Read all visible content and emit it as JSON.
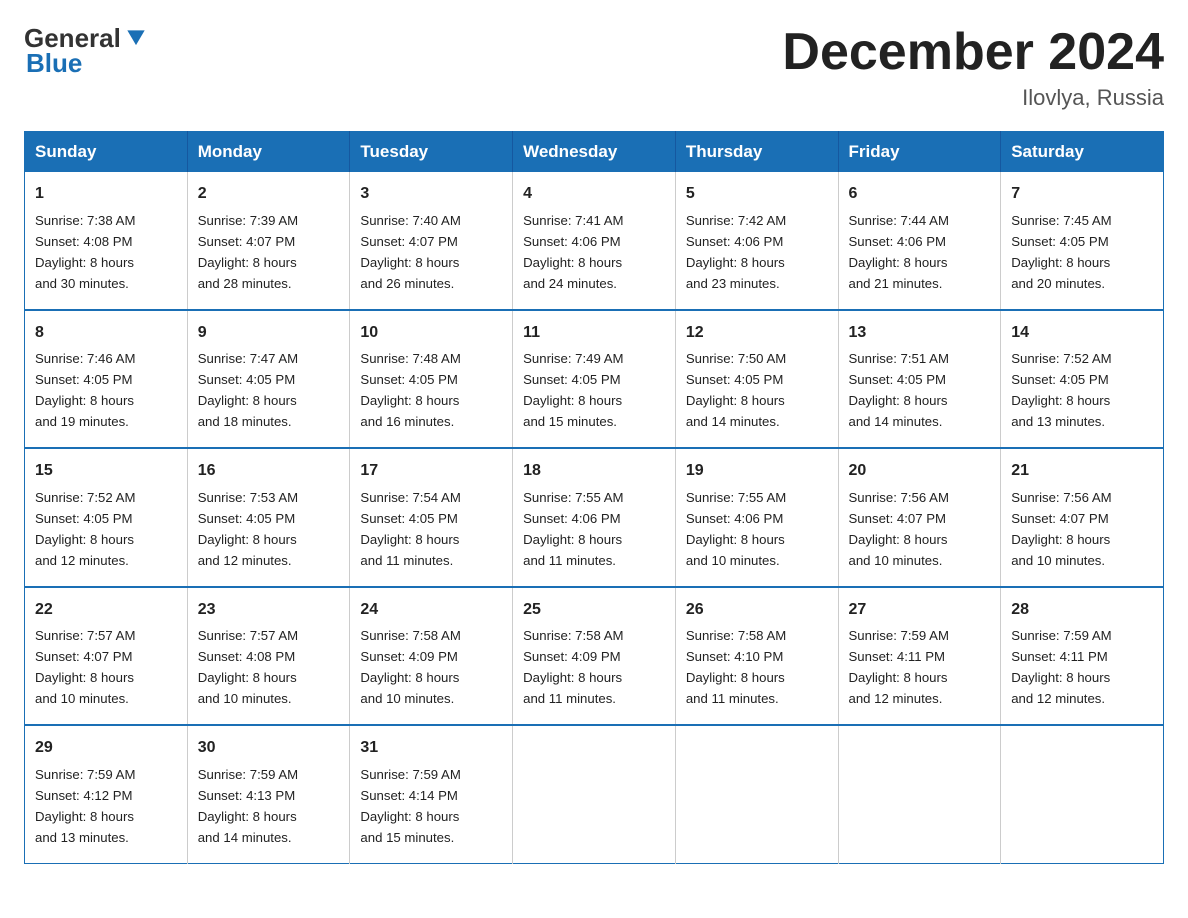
{
  "header": {
    "logo_general": "General",
    "logo_blue": "Blue",
    "month_title": "December 2024",
    "location": "Ilovlya, Russia"
  },
  "days_of_week": [
    "Sunday",
    "Monday",
    "Tuesday",
    "Wednesday",
    "Thursday",
    "Friday",
    "Saturday"
  ],
  "weeks": [
    [
      {
        "num": "1",
        "sunrise": "7:38 AM",
        "sunset": "4:08 PM",
        "daylight": "8 hours and 30 minutes."
      },
      {
        "num": "2",
        "sunrise": "7:39 AM",
        "sunset": "4:07 PM",
        "daylight": "8 hours and 28 minutes."
      },
      {
        "num": "3",
        "sunrise": "7:40 AM",
        "sunset": "4:07 PM",
        "daylight": "8 hours and 26 minutes."
      },
      {
        "num": "4",
        "sunrise": "7:41 AM",
        "sunset": "4:06 PM",
        "daylight": "8 hours and 24 minutes."
      },
      {
        "num": "5",
        "sunrise": "7:42 AM",
        "sunset": "4:06 PM",
        "daylight": "8 hours and 23 minutes."
      },
      {
        "num": "6",
        "sunrise": "7:44 AM",
        "sunset": "4:06 PM",
        "daylight": "8 hours and 21 minutes."
      },
      {
        "num": "7",
        "sunrise": "7:45 AM",
        "sunset": "4:05 PM",
        "daylight": "8 hours and 20 minutes."
      }
    ],
    [
      {
        "num": "8",
        "sunrise": "7:46 AM",
        "sunset": "4:05 PM",
        "daylight": "8 hours and 19 minutes."
      },
      {
        "num": "9",
        "sunrise": "7:47 AM",
        "sunset": "4:05 PM",
        "daylight": "8 hours and 18 minutes."
      },
      {
        "num": "10",
        "sunrise": "7:48 AM",
        "sunset": "4:05 PM",
        "daylight": "8 hours and 16 minutes."
      },
      {
        "num": "11",
        "sunrise": "7:49 AM",
        "sunset": "4:05 PM",
        "daylight": "8 hours and 15 minutes."
      },
      {
        "num": "12",
        "sunrise": "7:50 AM",
        "sunset": "4:05 PM",
        "daylight": "8 hours and 14 minutes."
      },
      {
        "num": "13",
        "sunrise": "7:51 AM",
        "sunset": "4:05 PM",
        "daylight": "8 hours and 14 minutes."
      },
      {
        "num": "14",
        "sunrise": "7:52 AM",
        "sunset": "4:05 PM",
        "daylight": "8 hours and 13 minutes."
      }
    ],
    [
      {
        "num": "15",
        "sunrise": "7:52 AM",
        "sunset": "4:05 PM",
        "daylight": "8 hours and 12 minutes."
      },
      {
        "num": "16",
        "sunrise": "7:53 AM",
        "sunset": "4:05 PM",
        "daylight": "8 hours and 12 minutes."
      },
      {
        "num": "17",
        "sunrise": "7:54 AM",
        "sunset": "4:05 PM",
        "daylight": "8 hours and 11 minutes."
      },
      {
        "num": "18",
        "sunrise": "7:55 AM",
        "sunset": "4:06 PM",
        "daylight": "8 hours and 11 minutes."
      },
      {
        "num": "19",
        "sunrise": "7:55 AM",
        "sunset": "4:06 PM",
        "daylight": "8 hours and 10 minutes."
      },
      {
        "num": "20",
        "sunrise": "7:56 AM",
        "sunset": "4:07 PM",
        "daylight": "8 hours and 10 minutes."
      },
      {
        "num": "21",
        "sunrise": "7:56 AM",
        "sunset": "4:07 PM",
        "daylight": "8 hours and 10 minutes."
      }
    ],
    [
      {
        "num": "22",
        "sunrise": "7:57 AM",
        "sunset": "4:07 PM",
        "daylight": "8 hours and 10 minutes."
      },
      {
        "num": "23",
        "sunrise": "7:57 AM",
        "sunset": "4:08 PM",
        "daylight": "8 hours and 10 minutes."
      },
      {
        "num": "24",
        "sunrise": "7:58 AM",
        "sunset": "4:09 PM",
        "daylight": "8 hours and 10 minutes."
      },
      {
        "num": "25",
        "sunrise": "7:58 AM",
        "sunset": "4:09 PM",
        "daylight": "8 hours and 11 minutes."
      },
      {
        "num": "26",
        "sunrise": "7:58 AM",
        "sunset": "4:10 PM",
        "daylight": "8 hours and 11 minutes."
      },
      {
        "num": "27",
        "sunrise": "7:59 AM",
        "sunset": "4:11 PM",
        "daylight": "8 hours and 12 minutes."
      },
      {
        "num": "28",
        "sunrise": "7:59 AM",
        "sunset": "4:11 PM",
        "daylight": "8 hours and 12 minutes."
      }
    ],
    [
      {
        "num": "29",
        "sunrise": "7:59 AM",
        "sunset": "4:12 PM",
        "daylight": "8 hours and 13 minutes."
      },
      {
        "num": "30",
        "sunrise": "7:59 AM",
        "sunset": "4:13 PM",
        "daylight": "8 hours and 14 minutes."
      },
      {
        "num": "31",
        "sunrise": "7:59 AM",
        "sunset": "4:14 PM",
        "daylight": "8 hours and 15 minutes."
      },
      null,
      null,
      null,
      null
    ]
  ],
  "labels": {
    "sunrise": "Sunrise:",
    "sunset": "Sunset:",
    "daylight": "Daylight:"
  }
}
